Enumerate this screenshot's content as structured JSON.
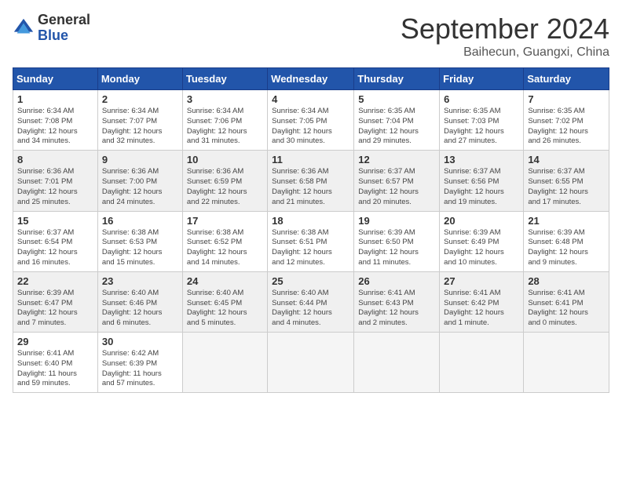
{
  "header": {
    "logo_general": "General",
    "logo_blue": "Blue",
    "title_month": "September 2024",
    "title_location": "Baihecun, Guangxi, China"
  },
  "weekdays": [
    "Sunday",
    "Monday",
    "Tuesday",
    "Wednesday",
    "Thursday",
    "Friday",
    "Saturday"
  ],
  "weeks": [
    {
      "shaded": false,
      "days": [
        {
          "num": "1",
          "info": "Sunrise: 6:34 AM\nSunset: 7:08 PM\nDaylight: 12 hours\nand 34 minutes."
        },
        {
          "num": "2",
          "info": "Sunrise: 6:34 AM\nSunset: 7:07 PM\nDaylight: 12 hours\nand 32 minutes."
        },
        {
          "num": "3",
          "info": "Sunrise: 6:34 AM\nSunset: 7:06 PM\nDaylight: 12 hours\nand 31 minutes."
        },
        {
          "num": "4",
          "info": "Sunrise: 6:34 AM\nSunset: 7:05 PM\nDaylight: 12 hours\nand 30 minutes."
        },
        {
          "num": "5",
          "info": "Sunrise: 6:35 AM\nSunset: 7:04 PM\nDaylight: 12 hours\nand 29 minutes."
        },
        {
          "num": "6",
          "info": "Sunrise: 6:35 AM\nSunset: 7:03 PM\nDaylight: 12 hours\nand 27 minutes."
        },
        {
          "num": "7",
          "info": "Sunrise: 6:35 AM\nSunset: 7:02 PM\nDaylight: 12 hours\nand 26 minutes."
        }
      ]
    },
    {
      "shaded": true,
      "days": [
        {
          "num": "8",
          "info": "Sunrise: 6:36 AM\nSunset: 7:01 PM\nDaylight: 12 hours\nand 25 minutes."
        },
        {
          "num": "9",
          "info": "Sunrise: 6:36 AM\nSunset: 7:00 PM\nDaylight: 12 hours\nand 24 minutes."
        },
        {
          "num": "10",
          "info": "Sunrise: 6:36 AM\nSunset: 6:59 PM\nDaylight: 12 hours\nand 22 minutes."
        },
        {
          "num": "11",
          "info": "Sunrise: 6:36 AM\nSunset: 6:58 PM\nDaylight: 12 hours\nand 21 minutes."
        },
        {
          "num": "12",
          "info": "Sunrise: 6:37 AM\nSunset: 6:57 PM\nDaylight: 12 hours\nand 20 minutes."
        },
        {
          "num": "13",
          "info": "Sunrise: 6:37 AM\nSunset: 6:56 PM\nDaylight: 12 hours\nand 19 minutes."
        },
        {
          "num": "14",
          "info": "Sunrise: 6:37 AM\nSunset: 6:55 PM\nDaylight: 12 hours\nand 17 minutes."
        }
      ]
    },
    {
      "shaded": false,
      "days": [
        {
          "num": "15",
          "info": "Sunrise: 6:37 AM\nSunset: 6:54 PM\nDaylight: 12 hours\nand 16 minutes."
        },
        {
          "num": "16",
          "info": "Sunrise: 6:38 AM\nSunset: 6:53 PM\nDaylight: 12 hours\nand 15 minutes."
        },
        {
          "num": "17",
          "info": "Sunrise: 6:38 AM\nSunset: 6:52 PM\nDaylight: 12 hours\nand 14 minutes."
        },
        {
          "num": "18",
          "info": "Sunrise: 6:38 AM\nSunset: 6:51 PM\nDaylight: 12 hours\nand 12 minutes."
        },
        {
          "num": "19",
          "info": "Sunrise: 6:39 AM\nSunset: 6:50 PM\nDaylight: 12 hours\nand 11 minutes."
        },
        {
          "num": "20",
          "info": "Sunrise: 6:39 AM\nSunset: 6:49 PM\nDaylight: 12 hours\nand 10 minutes."
        },
        {
          "num": "21",
          "info": "Sunrise: 6:39 AM\nSunset: 6:48 PM\nDaylight: 12 hours\nand 9 minutes."
        }
      ]
    },
    {
      "shaded": true,
      "days": [
        {
          "num": "22",
          "info": "Sunrise: 6:39 AM\nSunset: 6:47 PM\nDaylight: 12 hours\nand 7 minutes."
        },
        {
          "num": "23",
          "info": "Sunrise: 6:40 AM\nSunset: 6:46 PM\nDaylight: 12 hours\nand 6 minutes."
        },
        {
          "num": "24",
          "info": "Sunrise: 6:40 AM\nSunset: 6:45 PM\nDaylight: 12 hours\nand 5 minutes."
        },
        {
          "num": "25",
          "info": "Sunrise: 6:40 AM\nSunset: 6:44 PM\nDaylight: 12 hours\nand 4 minutes."
        },
        {
          "num": "26",
          "info": "Sunrise: 6:41 AM\nSunset: 6:43 PM\nDaylight: 12 hours\nand 2 minutes."
        },
        {
          "num": "27",
          "info": "Sunrise: 6:41 AM\nSunset: 6:42 PM\nDaylight: 12 hours\nand 1 minute."
        },
        {
          "num": "28",
          "info": "Sunrise: 6:41 AM\nSunset: 6:41 PM\nDaylight: 12 hours\nand 0 minutes."
        }
      ]
    },
    {
      "shaded": false,
      "days": [
        {
          "num": "29",
          "info": "Sunrise: 6:41 AM\nSunset: 6:40 PM\nDaylight: 11 hours\nand 59 minutes."
        },
        {
          "num": "30",
          "info": "Sunrise: 6:42 AM\nSunset: 6:39 PM\nDaylight: 11 hours\nand 57 minutes."
        },
        {
          "num": "",
          "info": ""
        },
        {
          "num": "",
          "info": ""
        },
        {
          "num": "",
          "info": ""
        },
        {
          "num": "",
          "info": ""
        },
        {
          "num": "",
          "info": ""
        }
      ]
    }
  ]
}
